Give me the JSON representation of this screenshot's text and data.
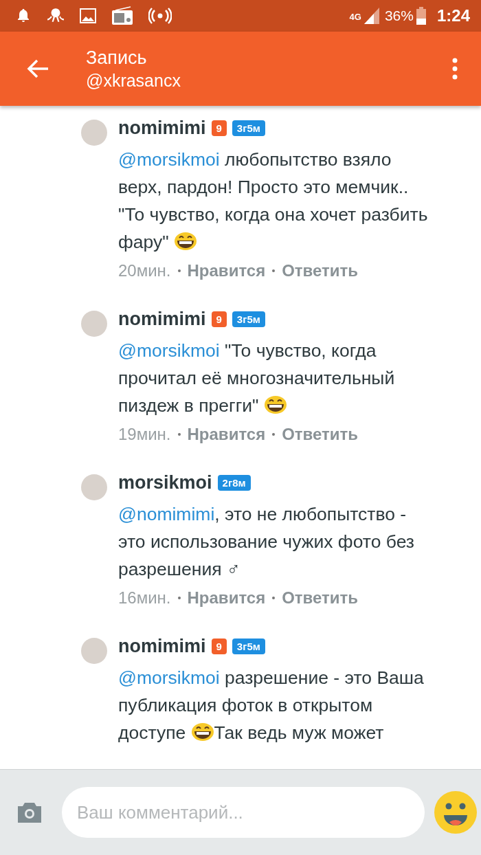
{
  "status_bar": {
    "network": "4G",
    "battery": "36%",
    "time": "1:24"
  },
  "app_bar": {
    "title": "Запись",
    "subtitle": "@xkrasancx"
  },
  "comments": [
    {
      "author": "nomimimi",
      "badges": [
        {
          "text": "9",
          "color": "#f25f2a"
        },
        {
          "text": "3г5м",
          "color": "#1e8fe0"
        }
      ],
      "body": [
        {
          "kind": "mention",
          "text": "@morsikmoi"
        },
        {
          "kind": "text",
          "text": " любопытство взяло верх, пардон! Просто это мемчик.. \"То чувство, когда она хочет разбить фару\" "
        },
        {
          "kind": "grin"
        }
      ],
      "time": "20мин.",
      "actions": [
        "Нравится",
        "Ответить"
      ]
    },
    {
      "author": "nomimimi",
      "badges": [
        {
          "text": "9",
          "color": "#f25f2a"
        },
        {
          "text": "3г5м",
          "color": "#1e8fe0"
        }
      ],
      "body": [
        {
          "kind": "mention",
          "text": "@morsikmoi"
        },
        {
          "kind": "text",
          "text": " \"То чувство, когда прочитал её многозначительный пиздеж в прегги\" "
        },
        {
          "kind": "grin"
        }
      ],
      "time": "19мин.",
      "actions": [
        "Нравится",
        "Ответить"
      ]
    },
    {
      "author": "morsikmoi",
      "badges": [
        {
          "text": "2г8м",
          "color": "#1e8fe0"
        }
      ],
      "body": [
        {
          "kind": "mention",
          "text": "@nomimimi"
        },
        {
          "kind": "text",
          "text": ", это не любопытство - это использование чужих фото без разрешения  ♂"
        }
      ],
      "time": "16мин.",
      "actions": [
        "Нравится",
        "Ответить"
      ]
    },
    {
      "author": "nomimimi",
      "badges": [
        {
          "text": "9",
          "color": "#f25f2a"
        },
        {
          "text": "3г5м",
          "color": "#1e8fe0"
        }
      ],
      "body": [
        {
          "kind": "mention",
          "text": "@morsikmoi"
        },
        {
          "kind": "text",
          "text": " разрешение - это Ваша публикация фоток в открытом доступе "
        },
        {
          "kind": "grin"
        },
        {
          "kind": "text",
          "text": "Так ведь муж может"
        }
      ]
    }
  ],
  "composer": {
    "placeholder": "Ваш комментарий..."
  }
}
